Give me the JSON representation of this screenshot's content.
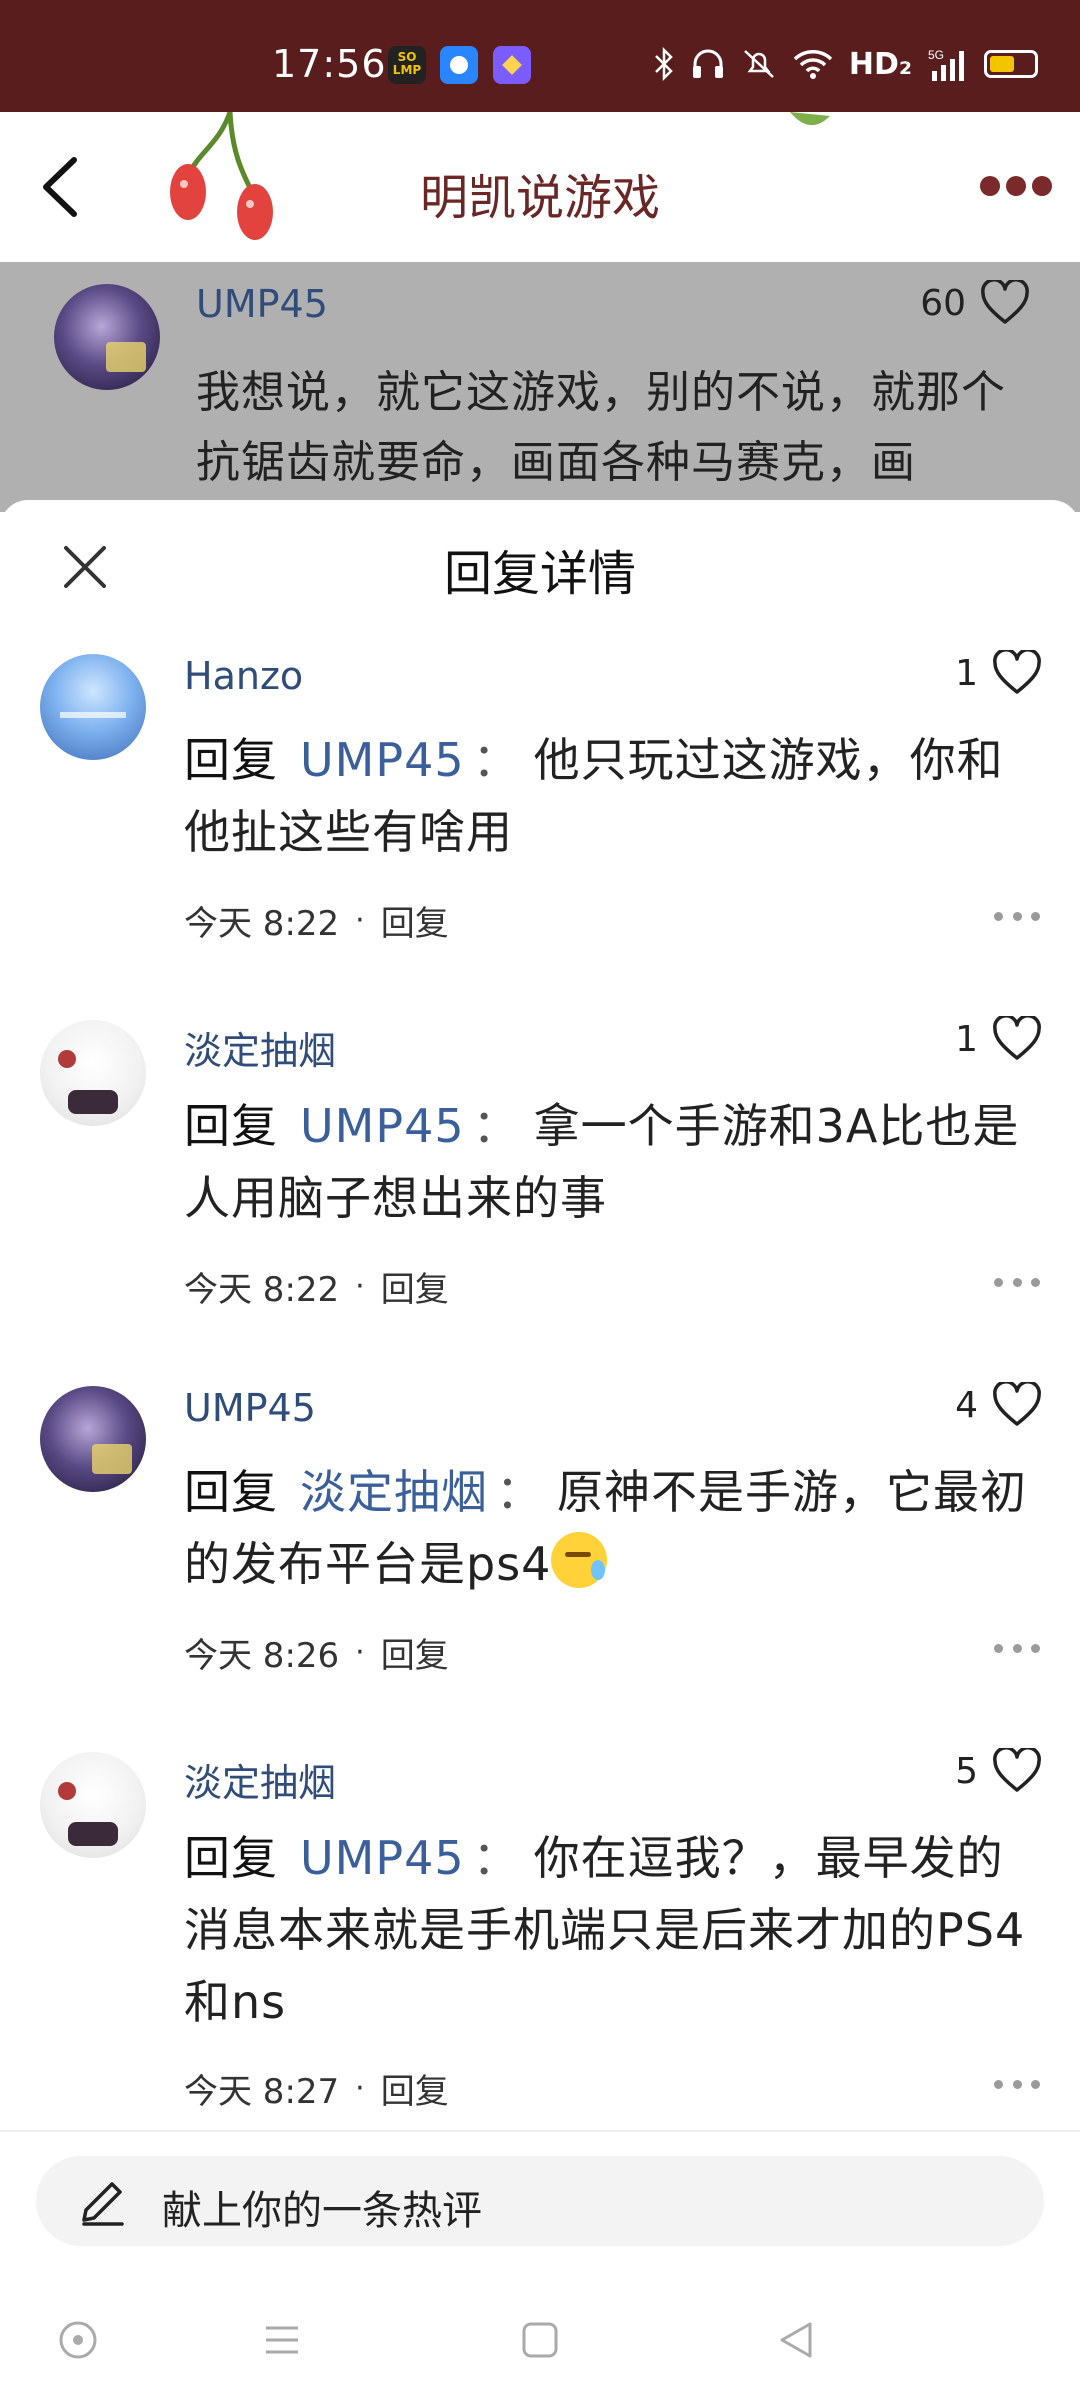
{
  "status_bar": {
    "time": "17:56",
    "app_icons": [
      "so-lmp-app-icon",
      "browser-app-icon",
      "game-app-icon"
    ],
    "app1_label": "SO\nLMP",
    "indicators": [
      "bluetooth-icon",
      "headphones-icon",
      "mute-icon",
      "wifi-icon"
    ],
    "hd": "HD₂",
    "network": "5G"
  },
  "header": {
    "title": "明凯说游戏",
    "accent": "#6b2626"
  },
  "parent_comment": {
    "author": "UMP45",
    "likes": "60",
    "text": "我想说，就它这游戏，别的不说，就那个抗锯齿就要命，画面各种马赛克，画"
  },
  "sheet": {
    "title": "回复详情"
  },
  "replies": [
    {
      "author": "Hanzo",
      "likes": "1",
      "prefix": "回复",
      "target": "UMP45",
      "separator": "：",
      "text": "他只玩过这游戏，你和他扯这些有啥用",
      "time": "今天 8:22",
      "reply_label": "回复",
      "avatar": "sky"
    },
    {
      "author": "淡定抽烟",
      "likes": "1",
      "prefix": "回复",
      "target": "UMP45",
      "separator": "：",
      "text": "拿一个手游和3A比也是人用脑子想出来的事",
      "time": "今天 8:22",
      "reply_label": "回复",
      "avatar": "white"
    },
    {
      "author": "UMP45",
      "likes": "4",
      "prefix": "回复",
      "target": "淡定抽烟",
      "separator": "：",
      "text": "原神不是手游，它最初的发布平台是ps4",
      "time": "今天 8:26",
      "reply_label": "回复",
      "avatar": "dark"
    },
    {
      "author": "淡定抽烟",
      "likes": "5",
      "prefix": "回复",
      "target": "UMP45",
      "separator": "：",
      "text": "你在逗我？，最早发的消息本来就是手机端只是后来才加的PS4和ns",
      "time": "今天 8:27",
      "reply_label": "回复",
      "avatar": "white"
    }
  ],
  "input": {
    "placeholder": "献上你的一条热评"
  },
  "colors": {
    "status_bar_bg": "#5a1d1d",
    "name_blue": "#2f4c7a",
    "mention_blue": "#3a5f9a"
  }
}
